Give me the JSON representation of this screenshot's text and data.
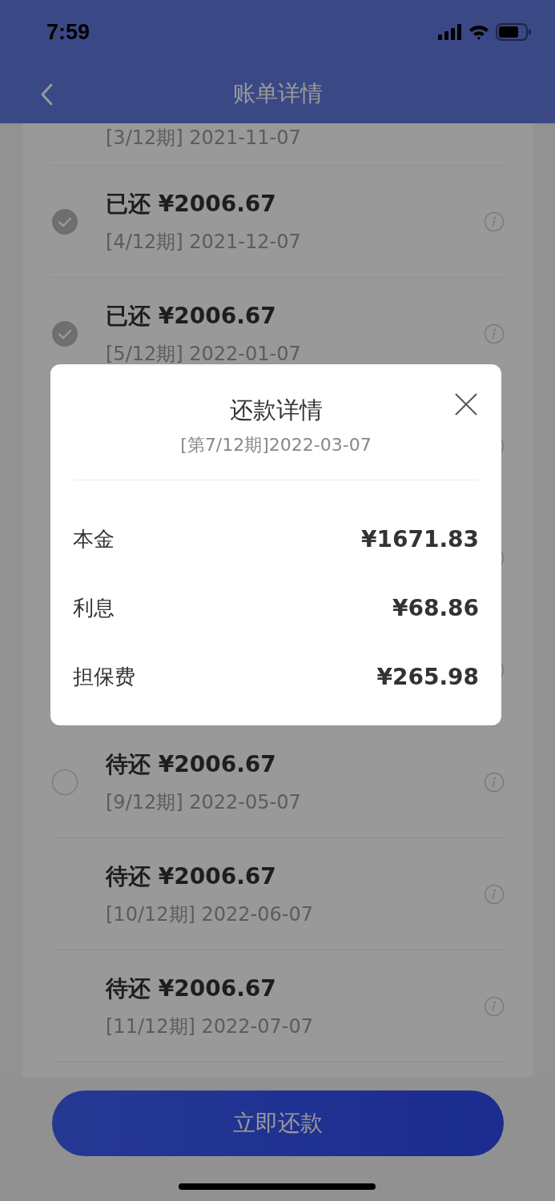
{
  "status_bar": {
    "time": "7:59"
  },
  "nav": {
    "title": "账单详情"
  },
  "installments": [
    {
      "kind": "partial",
      "date": "[3/12期] 2021-11-07"
    },
    {
      "kind": "full",
      "title": "已还 ¥2006.67",
      "date": "[4/12期] 2021-12-07",
      "checked": true
    },
    {
      "kind": "full",
      "title": "已还 ¥2006.67",
      "date": "[5/12期] 2022-01-07",
      "checked": true
    },
    {
      "kind": "covered"
    },
    {
      "kind": "covered"
    },
    {
      "kind": "covered"
    },
    {
      "kind": "full",
      "title": "待还 ¥2006.67",
      "date": "[9/12期] 2022-05-07",
      "checked": false
    },
    {
      "kind": "full",
      "title": "待还 ¥2006.67",
      "date": "[10/12期] 2022-06-07"
    },
    {
      "kind": "full",
      "title": "待还 ¥2006.67",
      "date": "[11/12期] 2022-07-07"
    }
  ],
  "dialog": {
    "title": "还款详情",
    "subtitle": "[第7/12期]2022-03-07",
    "items": [
      {
        "label": "本金",
        "value": "¥1671.83"
      },
      {
        "label": "利息",
        "value": "¥68.86"
      },
      {
        "label": "担保费",
        "value": "¥265.98"
      }
    ]
  },
  "primary_button": "立即还款"
}
